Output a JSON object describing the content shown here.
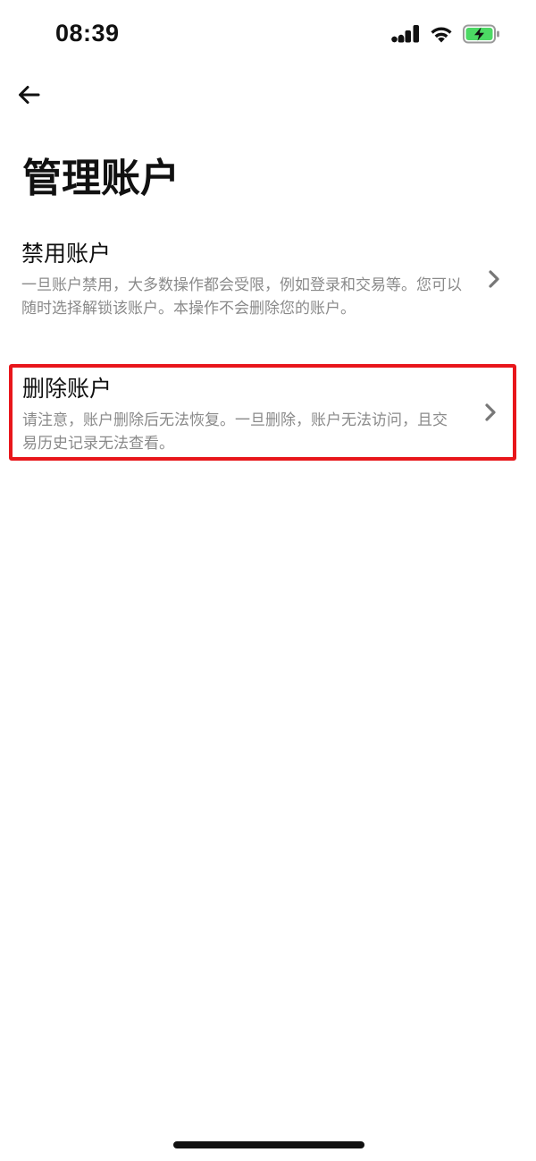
{
  "status_bar": {
    "time": "08:39",
    "icons": [
      "signal-icon",
      "wifi-icon",
      "battery-charging-icon"
    ],
    "battery_color": "#4cd964"
  },
  "nav": {
    "back_icon": "arrow-left-icon"
  },
  "page": {
    "title": "管理账户"
  },
  "options": [
    {
      "title": "禁用账户",
      "description": "一旦账户禁用，大多数操作都会受限，例如登录和交易等。您可以随时选择解锁该账户。本操作不会删除您的账户。",
      "icon": "chevron-right-icon"
    },
    {
      "title": "删除账户",
      "description": "请注意，账户删除后无法恢复。一旦删除，账户无法访问，且交易历史记录无法查看。",
      "icon": "chevron-right-icon",
      "highlight_color": "#e8161b"
    }
  ]
}
